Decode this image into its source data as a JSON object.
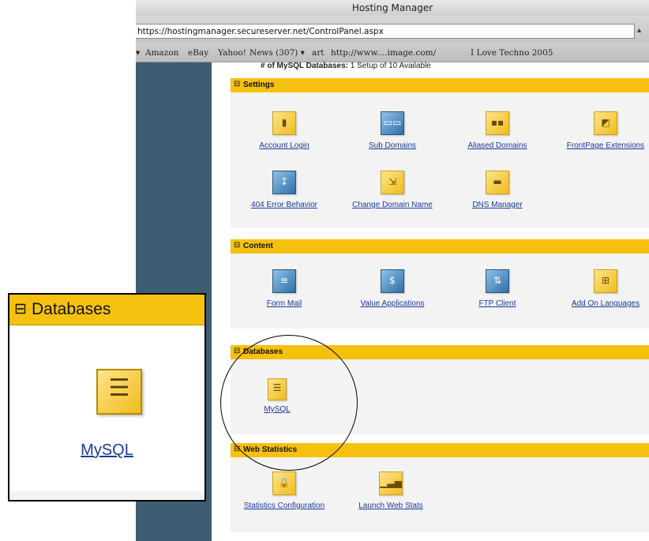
{
  "window": {
    "title": "Hosting Manager"
  },
  "address_bar": {
    "url": "https://hostingmanager.secureserver.net/ControlPanel.aspx"
  },
  "bookmarks": [
    {
      "label": "▾"
    },
    {
      "label": "Amazon"
    },
    {
      "label": "eBay"
    },
    {
      "label": "Yahoo!"
    },
    {
      "label": "News (307) ▾"
    },
    {
      "label": "art"
    },
    {
      "label": "http://www....image.com/"
    },
    {
      "label": "I Love Techno 2005"
    }
  ],
  "info_line": {
    "label": "# of MySQL Databases:",
    "value": "1 Setup of 10 Available"
  },
  "sections": {
    "settings": {
      "title": "Settings",
      "tools": [
        {
          "label": "Account Login",
          "icon": "account-login-icon"
        },
        {
          "label": "Sub Domains",
          "icon": "sub-domains-icon"
        },
        {
          "label": "Aliased Domains",
          "icon": "aliased-domains-icon"
        },
        {
          "label": "FrontPage Extensions",
          "icon": "frontpage-icon"
        },
        {
          "label": "404 Error Behavior",
          "icon": "error-behavior-icon"
        },
        {
          "label": "Change Domain Name",
          "icon": "change-domain-icon"
        },
        {
          "label": "DNS Manager",
          "icon": "dns-manager-icon"
        }
      ]
    },
    "content": {
      "title": "Content",
      "tools": [
        {
          "label": "Form Mail",
          "icon": "form-mail-icon"
        },
        {
          "label": "Value Applications",
          "icon": "value-applications-icon"
        },
        {
          "label": "FTP Client",
          "icon": "ftp-client-icon"
        },
        {
          "label": "Add On Languages",
          "icon": "add-on-languages-icon"
        }
      ]
    },
    "databases": {
      "title": "Databases",
      "tools": [
        {
          "label": "MySQL",
          "icon": "mysql-icon"
        }
      ]
    },
    "web_statistics": {
      "title": "Web Statistics",
      "tools": [
        {
          "label": "Statistics Configuration",
          "icon": "statistics-config-icon"
        },
        {
          "label": "Launch Web Stats",
          "icon": "launch-stats-icon"
        }
      ]
    }
  },
  "zoom": {
    "title": "Databases",
    "link": "MySQL"
  },
  "colors": {
    "section_bar": "#f6c10e",
    "link": "#1a3a9a",
    "sidebar": "#3f5d72"
  }
}
